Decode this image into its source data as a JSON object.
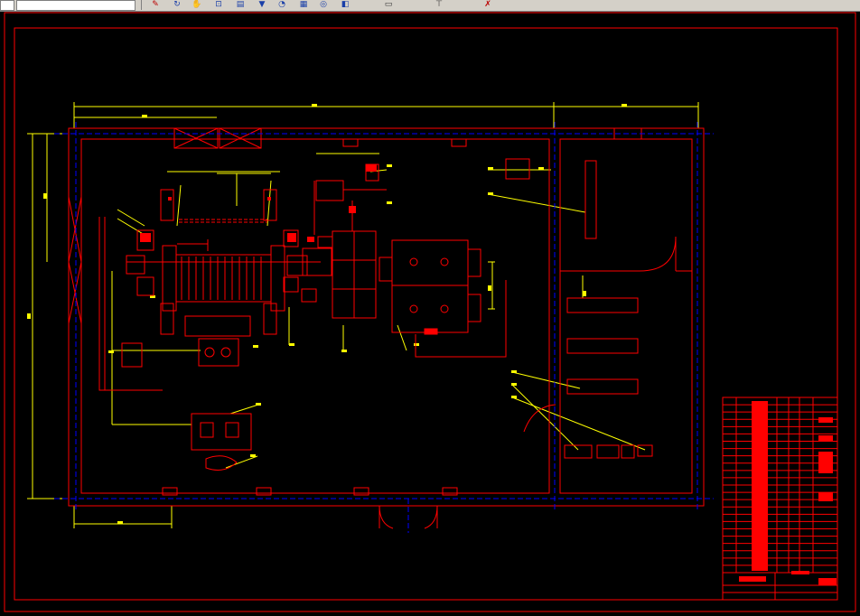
{
  "app": {
    "title": "",
    "accent_color": "#ffff00"
  },
  "toolbar": {
    "icons": [
      "layers-icon",
      "redo-icon",
      "pan-icon",
      "zoom-window-icon",
      "zoom-previous-icon",
      "properties-icon",
      "design-center-icon",
      "tool-palette-icon",
      "markup-icon",
      "calculator-icon",
      "match-properties-icon",
      "help-icon"
    ]
  },
  "drawing": {
    "line_color": "#ff0000",
    "dimension_color": "#ffff00",
    "centerline_color": "#0000ff",
    "title_block": {
      "rows": 24,
      "fill_color": "#ff0000"
    }
  }
}
